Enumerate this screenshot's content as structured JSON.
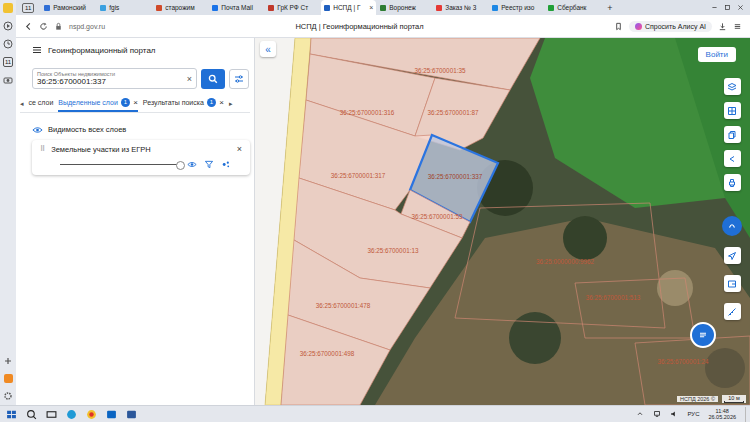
{
  "browser": {
    "sidebar": {
      "calendar_day": "11"
    },
    "tab_count": "11",
    "tabs": [
      {
        "label": "Рамонский",
        "selected": false,
        "color": "#2f6fd6"
      },
      {
        "label": "fgis",
        "selected": false,
        "color": "#3aa0e0"
      },
      {
        "label": "старожим",
        "selected": false,
        "color": "#d04a2a"
      },
      {
        "label": "Почта Mail",
        "selected": false,
        "color": "#1a73e8"
      },
      {
        "label": "ГрК РФ Ст",
        "selected": false,
        "color": "#c0392b"
      },
      {
        "label": "НСПД | Г",
        "selected": true,
        "color": "#1f5fbf"
      },
      {
        "label": "Воронеж",
        "selected": false,
        "color": "#2e7d32"
      },
      {
        "label": "Заказ № 3",
        "selected": false,
        "color": "#e53935"
      },
      {
        "label": "Реестр изо",
        "selected": false,
        "color": "#1e88e5"
      },
      {
        "label": "Сбербанк",
        "selected": false,
        "color": "#21a038"
      }
    ],
    "close_tab": "×",
    "new_tab": "+",
    "url": "nspd.gov.ru",
    "page_title": "НСПД | Геоинформационный портал",
    "assistant": "Спросить Алису AI"
  },
  "portal": {
    "title": "Геоинформационный портал",
    "collapse": "«",
    "search": {
      "label": "Поиск Объекты недвижимости",
      "value": "36:25:6700001:337",
      "clear": "×"
    },
    "tab_prev": "◂",
    "tab_next": "▸",
    "tabs": [
      {
        "label": "се слои",
        "selected": false,
        "badge": "",
        "close": ""
      },
      {
        "label": "Выделенные слои",
        "selected": true,
        "badge": "1",
        "close": "×"
      },
      {
        "label": "Результаты поиска",
        "selected": false,
        "badge": "1",
        "close": "×"
      }
    ],
    "visibility_label": "Видимость всех слоев",
    "layers": [
      {
        "name": "Земельные участки из ЕГРН",
        "handle": "⠿",
        "close": "×",
        "level": 1,
        "visible": true
      }
    ]
  },
  "map": {
    "login": "Войти",
    "parcels": [
      {
        "label": "36:25:6700001:35",
        "selected": false
      },
      {
        "label": "36:25:6700001:316",
        "selected": false
      },
      {
        "label": "36:25:6700001:87",
        "selected": false
      },
      {
        "label": "36:25:6700001:317",
        "selected": false
      },
      {
        "label": "36:25:6700001:337",
        "selected": true
      },
      {
        "label": "36:25:6700001:53",
        "selected": false
      },
      {
        "label": "36:25:6700001:13",
        "selected": false
      },
      {
        "label": "36:25:6700001:478",
        "selected": false
      },
      {
        "label": "36:25:6700001:498",
        "selected": false
      },
      {
        "label": "36:25:0000000:9962",
        "selected": false
      },
      {
        "label": "36:25:6700001:513",
        "selected": false
      },
      {
        "label": "36:25:6700001:24",
        "selected": false
      }
    ],
    "attribution": "НСПД 2026 ©",
    "scale": "10 м"
  },
  "taskbar": {
    "language": "РУС",
    "time": "11:48",
    "date": "26.05.2026"
  }
}
